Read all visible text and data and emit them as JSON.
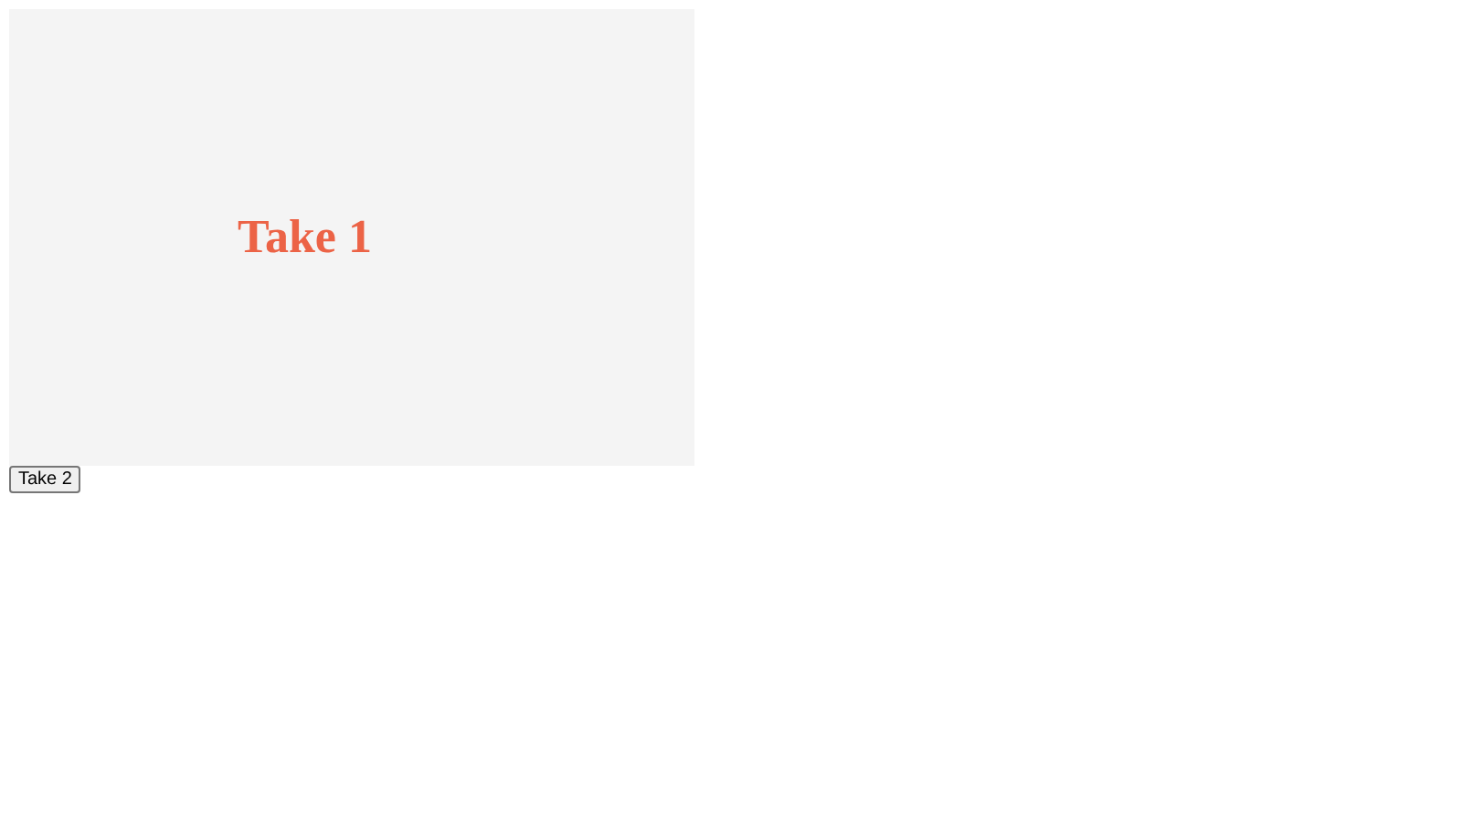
{
  "stage": {
    "heading": "Take 1"
  },
  "button": {
    "label": "Take 2"
  }
}
